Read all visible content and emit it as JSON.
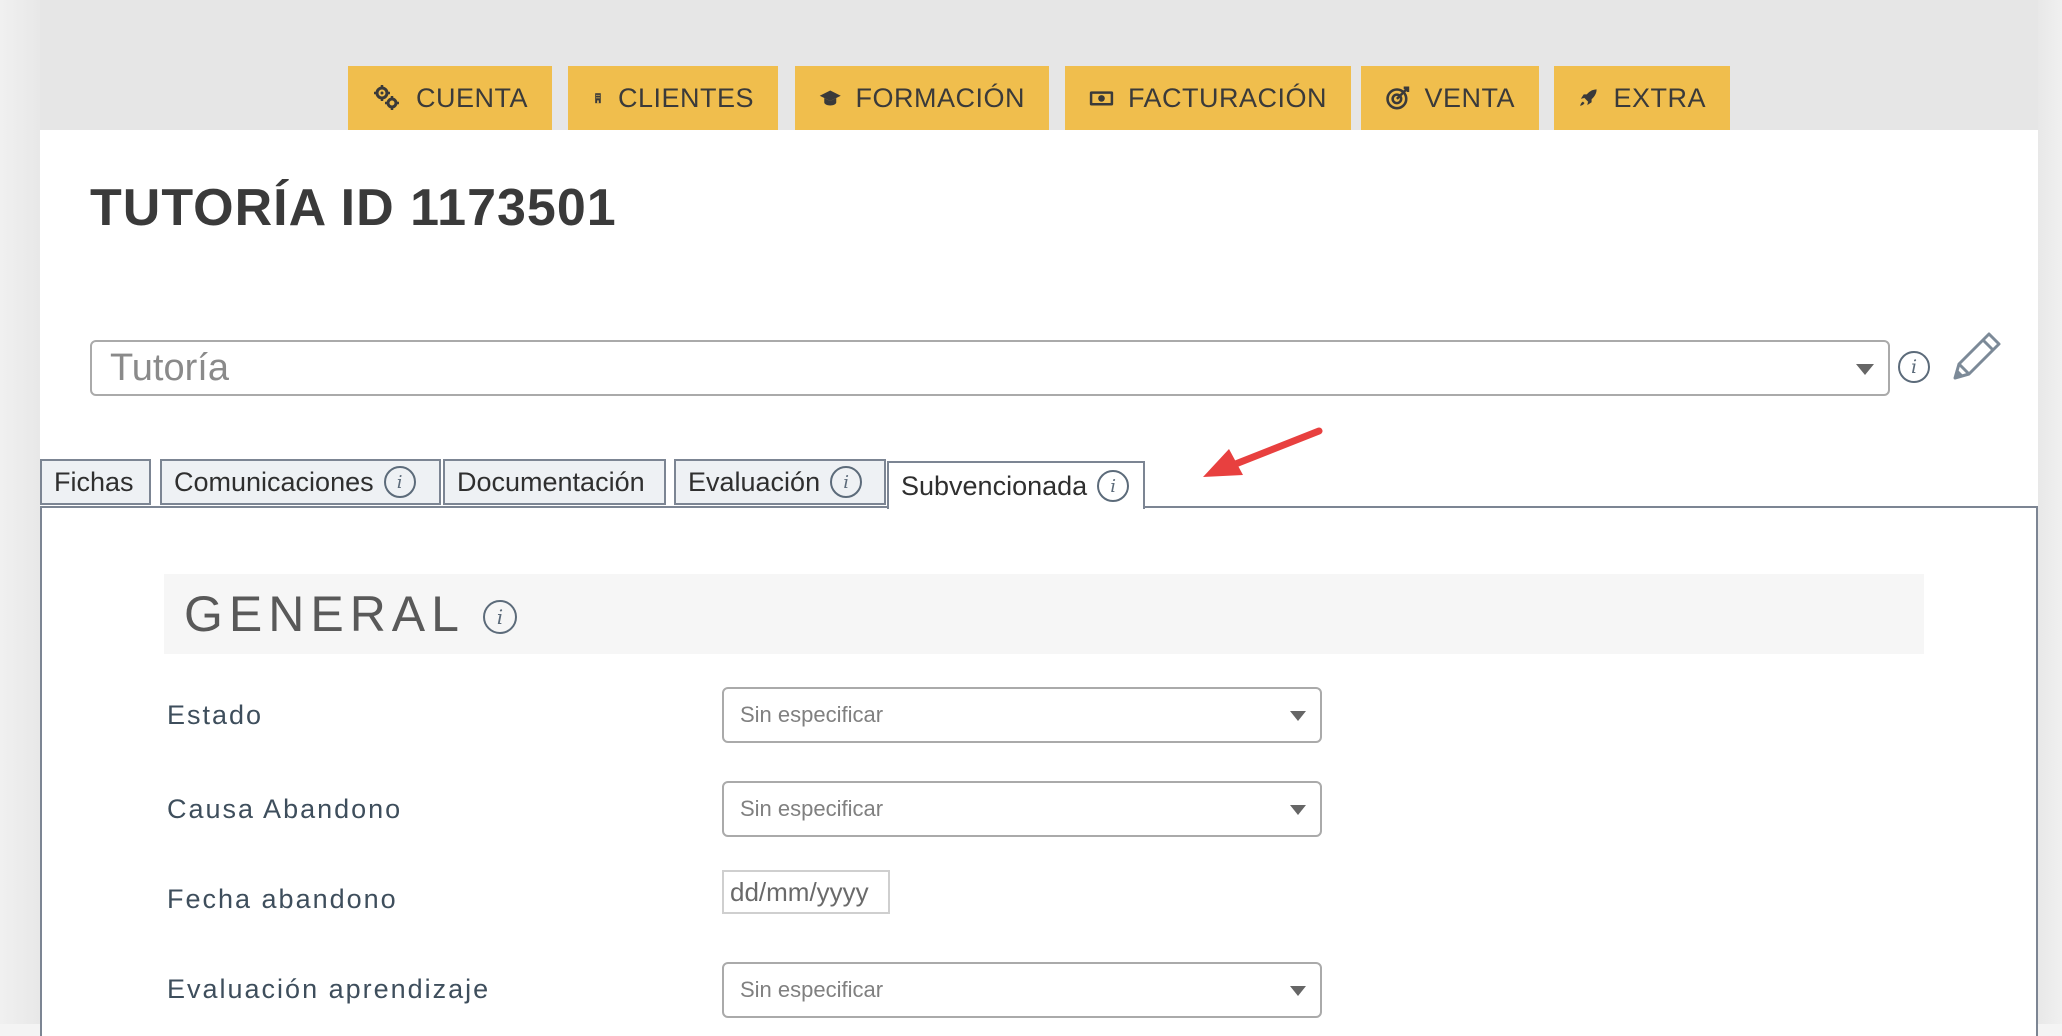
{
  "nav": {
    "items": [
      {
        "label": "CUENTA",
        "icon": "gears-icon"
      },
      {
        "label": "CLIENTES",
        "icon": "building-icon"
      },
      {
        "label": "FORMACIÓN",
        "icon": "graduation-cap-icon"
      },
      {
        "label": "FACTURACIÓN",
        "icon": "money-bill-icon"
      },
      {
        "label": "VENTA",
        "icon": "bullseye-icon"
      },
      {
        "label": "EXTRA",
        "icon": "rocket-icon"
      }
    ],
    "accent_color": "#f0be4d"
  },
  "page": {
    "title": "TUTORÍA ID 1173501"
  },
  "type_select": {
    "value": "Tutoría"
  },
  "tabs": [
    {
      "label": "Fichas",
      "info": false
    },
    {
      "label": "Comunicaciones",
      "info": true
    },
    {
      "label": "Documentación",
      "info": false
    },
    {
      "label": "Evaluación",
      "info": true
    },
    {
      "label": "Subvencionada",
      "info": true,
      "active": true
    }
  ],
  "annotation": {
    "arrow_color": "#e8403f"
  },
  "section": {
    "title": "GENERAL"
  },
  "form": {
    "estado": {
      "label": "Estado",
      "value": "Sin especificar"
    },
    "causa_abandono": {
      "label": "Causa Abandono",
      "value": "Sin especificar"
    },
    "fecha_abandono": {
      "label": "Fecha abandono",
      "placeholder": "dd/mm/yyyy"
    },
    "evaluacion_aprendizaje": {
      "label": "Evaluación aprendizaje",
      "value": "Sin especificar"
    }
  }
}
